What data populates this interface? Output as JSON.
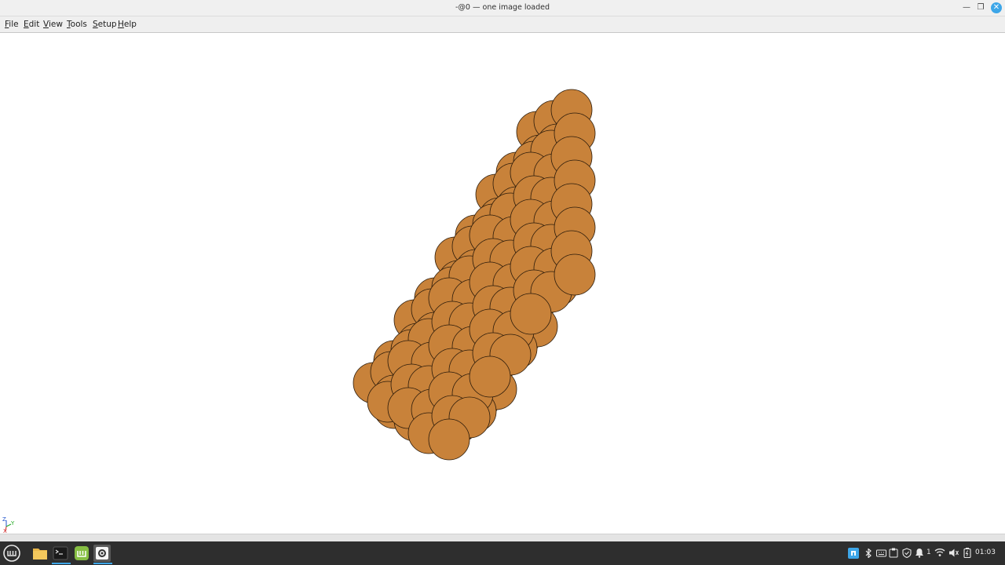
{
  "window": {
    "title": "-@0 — one image loaded",
    "controls": {
      "minimize": "—",
      "maximize": "❐",
      "close": "✕"
    }
  },
  "menubar": {
    "items": [
      {
        "underline": "F",
        "rest": "ile"
      },
      {
        "underline": "E",
        "rest": "dit"
      },
      {
        "underline": "V",
        "rest": "iew"
      },
      {
        "underline": "T",
        "rest": "ools"
      },
      {
        "underline": "S",
        "rest": "etup"
      },
      {
        "underline": "H",
        "rest": "elp"
      }
    ]
  },
  "viewport": {
    "sphere_fill": "#c8823a",
    "sphere_stroke": "#2a1a0a",
    "axes": {
      "z": "Z",
      "y": "Y",
      "x": "X"
    }
  },
  "taskbar": {
    "background": "#2e2e2e",
    "accent": "#3da6e8",
    "icons": [
      "mint-menu-icon",
      "file-manager-icon",
      "terminal-icon",
      "mintinstall-icon",
      "app-settings-icon"
    ],
    "tray": {
      "workspace_count": "1",
      "clock": "01:03"
    }
  }
}
